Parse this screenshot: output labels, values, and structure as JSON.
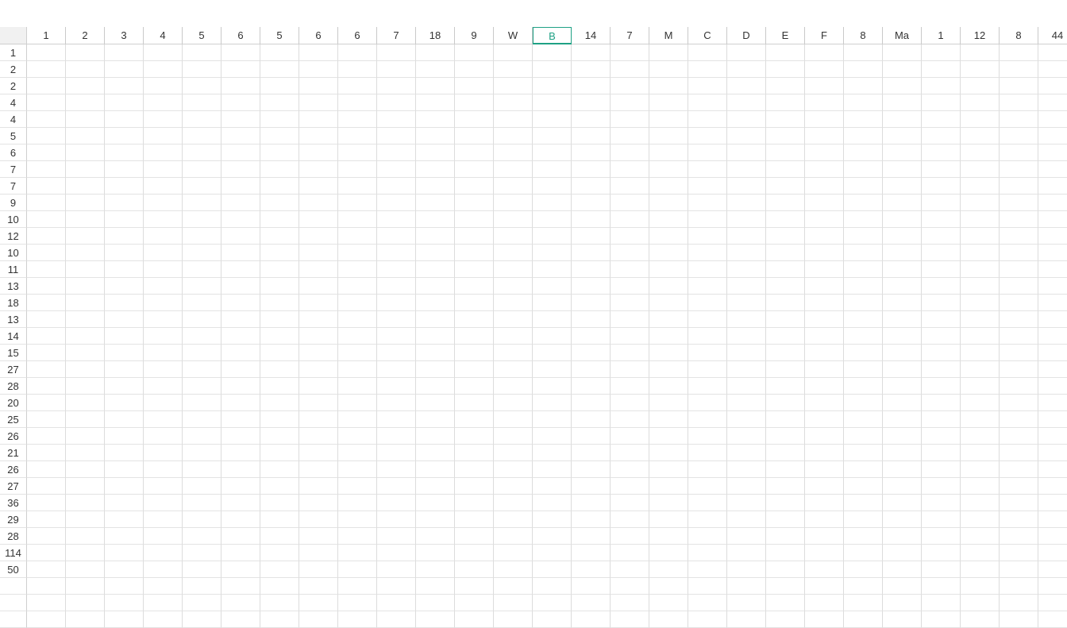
{
  "columns": [
    "1",
    "2",
    "3",
    "4",
    "5",
    "6",
    "5",
    "6",
    "6",
    "7",
    "18",
    "9",
    "W",
    "B",
    "14",
    "7",
    "M",
    "C",
    "D",
    "E",
    "F",
    "8",
    "Ma",
    "1",
    "12",
    "8",
    "44"
  ],
  "selected_column_index": 13,
  "rows": [
    "1",
    "2",
    "2",
    "4",
    "4",
    "5",
    "6",
    "7",
    "7",
    "9",
    "10",
    "12",
    "10",
    "11",
    "13",
    "18",
    "13",
    "14",
    "15",
    "27",
    "28",
    "20",
    "25",
    "26",
    "21",
    "26",
    "27",
    "36",
    "29",
    "28",
    "114",
    "50",
    "",
    "",
    ""
  ],
  "cell_value": ""
}
